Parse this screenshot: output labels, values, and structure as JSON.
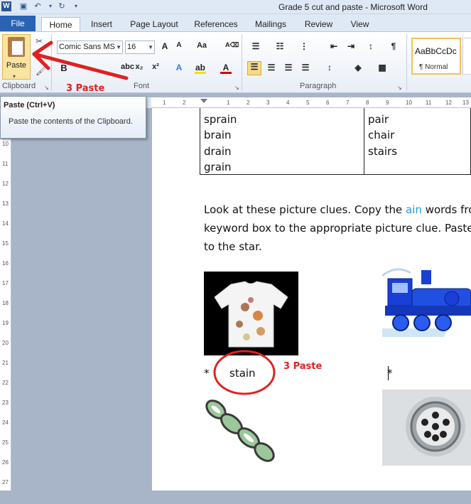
{
  "window": {
    "title": "Grade 5 cut and paste  -  Microsoft Word"
  },
  "tabs": [
    "File",
    "Home",
    "Insert",
    "Page Layout",
    "References",
    "Mailings",
    "Review",
    "View"
  ],
  "ribbon": {
    "paste_label": "Paste",
    "font_name": "Comic Sans MS",
    "font_size": "16",
    "groups": {
      "clipboard": "Clipboard",
      "font": "Font",
      "paragraph": "Paragraph"
    },
    "style_sample": "AaBbCcDc",
    "style_name": "¶ Normal"
  },
  "tooltip": {
    "title": "Paste (Ctrl+V)",
    "description": "Paste the contents of the Clipboard."
  },
  "annotations": {
    "paste_note_ribbon": "3 Paste",
    "paste_note_doc": "3 Paste"
  },
  "document": {
    "left_words": [
      "sprain",
      "brain",
      "drain",
      "grain"
    ],
    "right_words": [
      "pair",
      "chair",
      "stairs"
    ],
    "instruction_line1_a": "Look at these picture clues. Copy the ",
    "instruction_line1_ain": "ain",
    "instruction_line1_b": " words fro",
    "instruction_line2": "keyword box to the appropriate picture clue. Paste",
    "instruction_line3": "to the star.",
    "star": "*",
    "answer_word": "stain"
  },
  "rulers": {
    "h_ticks": [
      "1",
      "2",
      "1",
      "1",
      "2",
      "3",
      "4",
      "5",
      "6",
      "7",
      "8",
      "9",
      "10",
      "11",
      "12",
      "13"
    ],
    "v_ticks": [
      "10",
      "11",
      "12",
      "13",
      "14",
      "15",
      "16",
      "17",
      "18",
      "19",
      "20",
      "21",
      "22",
      "23",
      "24",
      "25",
      "26",
      "27"
    ]
  },
  "colors": {
    "file_tab": "#2a62b4",
    "accent_ain": "#1f9dd9",
    "annotation_red": "#e02020"
  }
}
